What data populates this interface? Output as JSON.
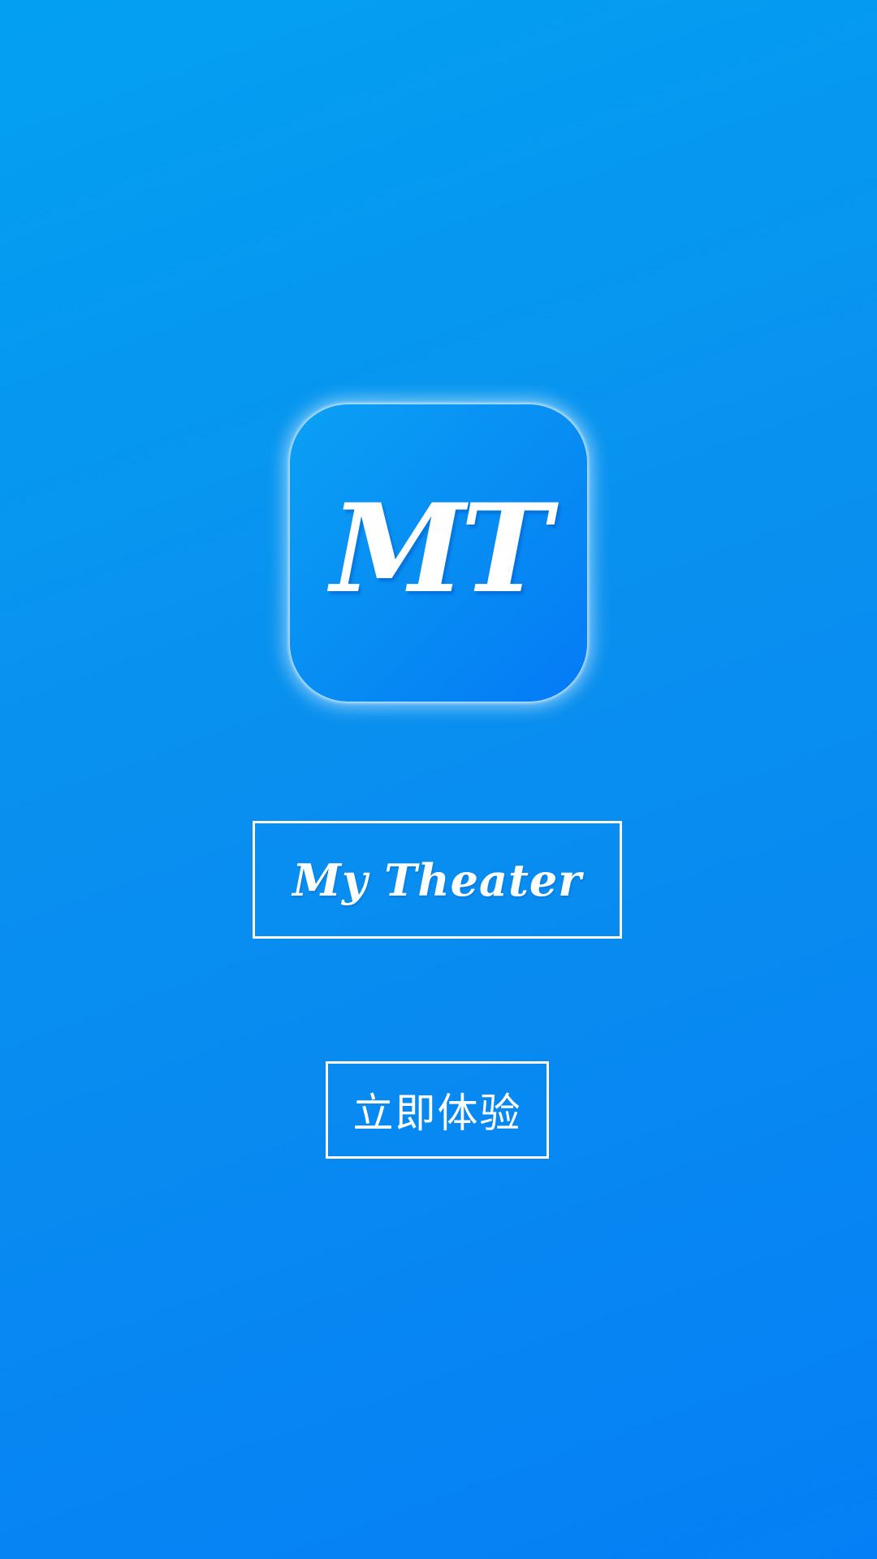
{
  "splash": {
    "logo_text": "MT",
    "app_name": "My Theater",
    "cta_label": "立即体验"
  },
  "colors": {
    "background_top": "#03a0f2",
    "background_bottom": "#057ff5",
    "foreground": "#ffffff"
  }
}
